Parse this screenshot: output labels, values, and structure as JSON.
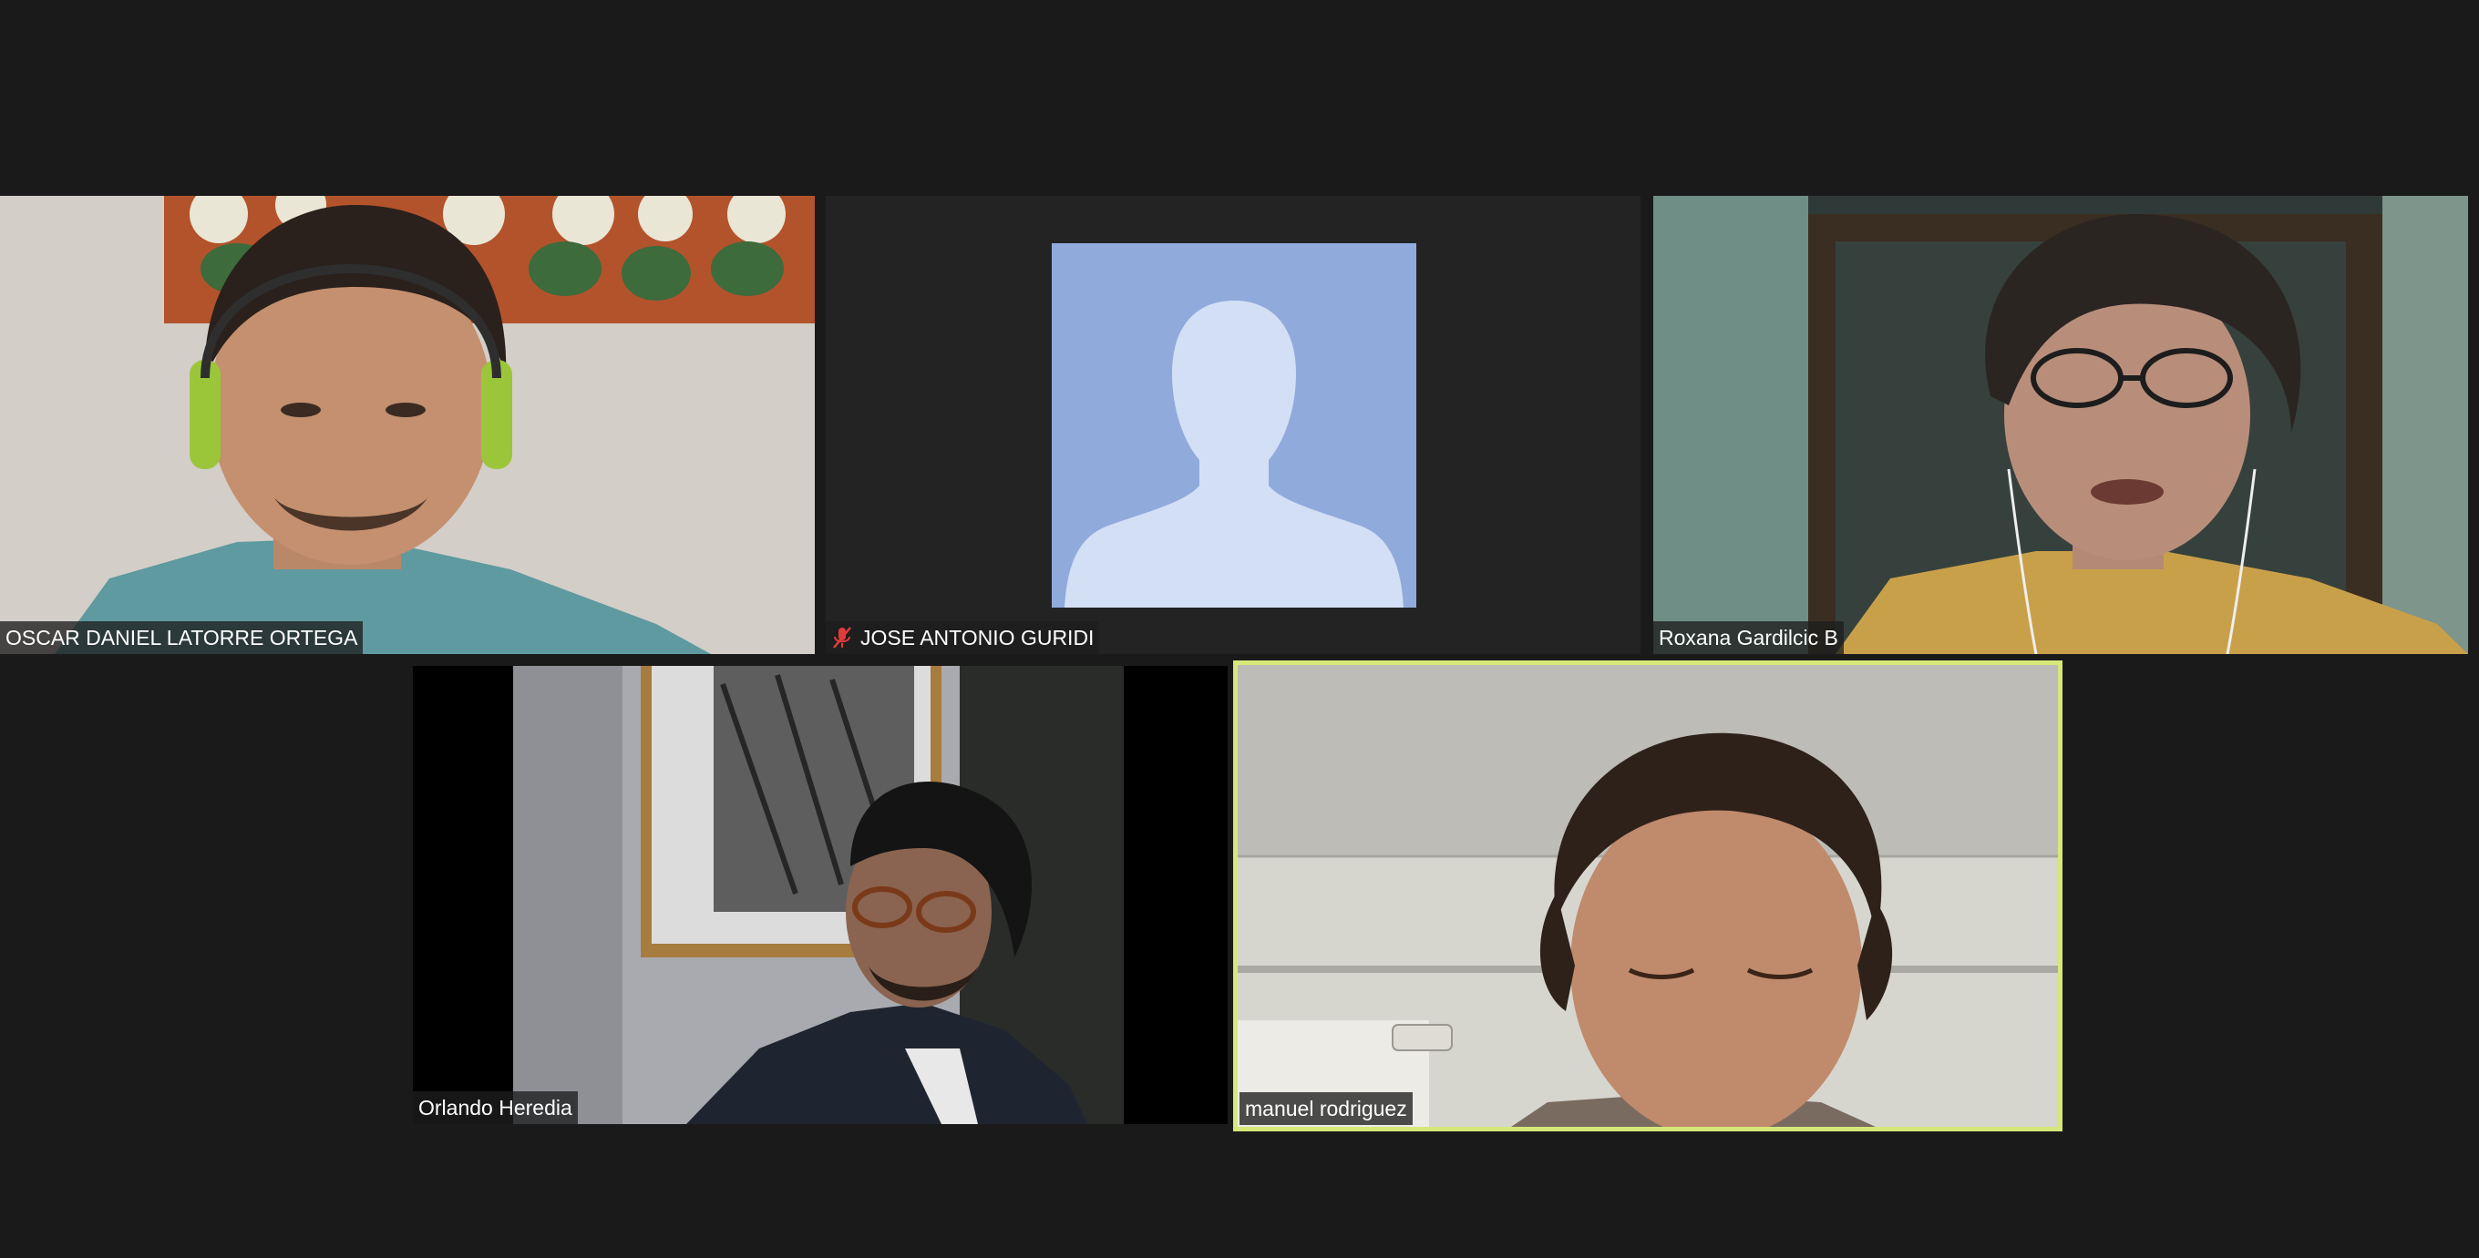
{
  "meeting": {
    "view": "gallery",
    "active_speaker_color": "#d6e879",
    "background_color": "#1a1a1a"
  },
  "participants": [
    {
      "name": "OSCAR DANIEL LATORRE ORTEGA",
      "muted": false,
      "video_on": true,
      "active_speaker": false
    },
    {
      "name": "JOSE ANTONIO GURIDI",
      "muted": true,
      "video_on": false,
      "active_speaker": false,
      "avatar_icon": "default-person-silhouette-icon",
      "avatar_color": "#91aadc"
    },
    {
      "name": "Roxana Gardilcic B",
      "muted": false,
      "video_on": true,
      "active_speaker": false
    },
    {
      "name": "Orlando Heredia",
      "muted": false,
      "video_on": true,
      "active_speaker": false
    },
    {
      "name": "manuel rodriguez",
      "muted": false,
      "video_on": true,
      "active_speaker": true
    }
  ]
}
